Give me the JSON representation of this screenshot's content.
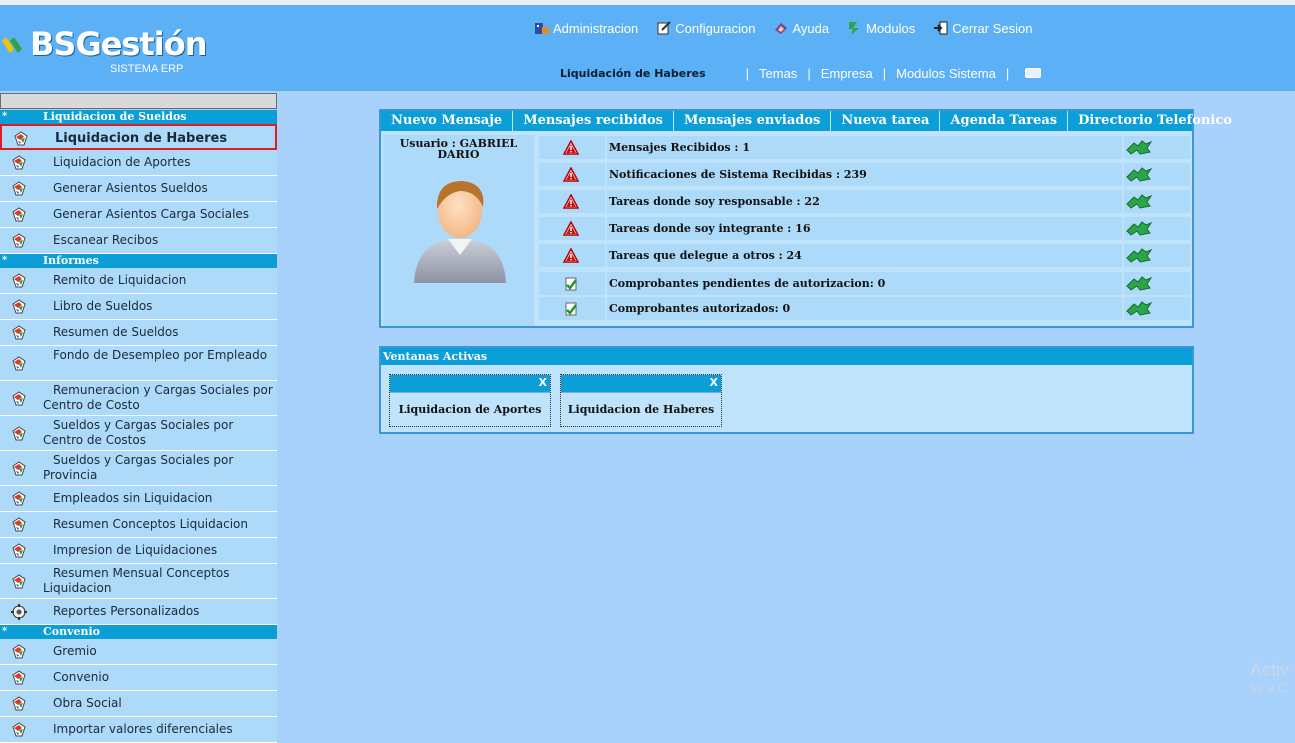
{
  "logo": {
    "brand": "BSGestión",
    "subtitle": "SISTEMA ERP"
  },
  "topnav": [
    {
      "label": "Administracion",
      "icon": "admin-icon"
    },
    {
      "label": "Configuracion",
      "icon": "config-icon"
    },
    {
      "label": "Ayuda",
      "icon": "help-icon"
    },
    {
      "label": "Modulos",
      "icon": "modules-icon"
    },
    {
      "label": "Cerrar Sesion",
      "icon": "logout-icon"
    }
  ],
  "subnav": {
    "current": "Liquidación de Haberes",
    "links": [
      "Temas",
      "Empresa",
      "Modulos Sistema"
    ],
    "sep": "|"
  },
  "sidebar": {
    "star": "*",
    "sections": [
      {
        "title": "Liquidacion de Sueldos",
        "items": [
          "Liquidacion de Haberes",
          "Liquidacion de Aportes",
          "Generar Asientos Sueldos",
          "Generar Asientos Carga Sociales",
          "Escanear Recibos"
        ]
      },
      {
        "title": "Informes",
        "items": [
          "Remito de Liquidacion",
          "Libro de Sueldos",
          "Resumen de Sueldos",
          "Fondo de Desempleo por Empleado",
          "Remuneracion y Cargas Sociales por Centro de Costo",
          "Sueldos y Cargas Sociales por Centro de Costos",
          "Sueldos y Cargas Sociales por Provincia",
          "Empleados sin Liquidacion",
          "Resumen Conceptos Liquidacion",
          "Impresion de Liquidaciones",
          "Resumen Mensual Conceptos Liquidacion",
          "Reportes Personalizados"
        ]
      },
      {
        "title": "Convenio",
        "items": [
          "Gremio",
          "Convenio",
          "Obra Social",
          "Importar valores diferenciales"
        ]
      }
    ]
  },
  "tabs": [
    "Nuevo Mensaje",
    "Mensajes recibidos",
    "Mensajes enviados",
    "Nueva tarea",
    "Agenda Tareas",
    "Directorio Telefonico"
  ],
  "user": {
    "label": "Usuario : GABRIEL DARIO"
  },
  "notifications": [
    {
      "text": "Mensajes Recibidos : 1",
      "icon": "warning-icon"
    },
    {
      "text": "Notificaciones de Sistema Recibidas : 239",
      "icon": "warning-icon"
    },
    {
      "text": "Tareas donde soy responsable : 22",
      "icon": "warning-icon"
    },
    {
      "text": "Tareas donde soy integrante : 16",
      "icon": "warning-icon"
    },
    {
      "text": "Tareas que delegue a otros : 24",
      "icon": "warning-icon"
    },
    {
      "text": "Comprobantes pendientes de autorizacion: 0",
      "icon": "check-icon"
    },
    {
      "text": "Comprobantes autorizados: 0",
      "icon": "check-icon"
    }
  ],
  "active_windows": {
    "title": "Ventanas Activas",
    "close_label": "X",
    "windows": [
      "Liquidacion de Aportes",
      "Liquidacion de Haberes"
    ]
  },
  "watermark": {
    "line1": "Activ",
    "line2": "Ve a C"
  },
  "colors": {
    "header": "#5cb0f5",
    "accent": "#0c9ed7",
    "background": "#a8d1fb",
    "selected_border": "#e01b24"
  }
}
